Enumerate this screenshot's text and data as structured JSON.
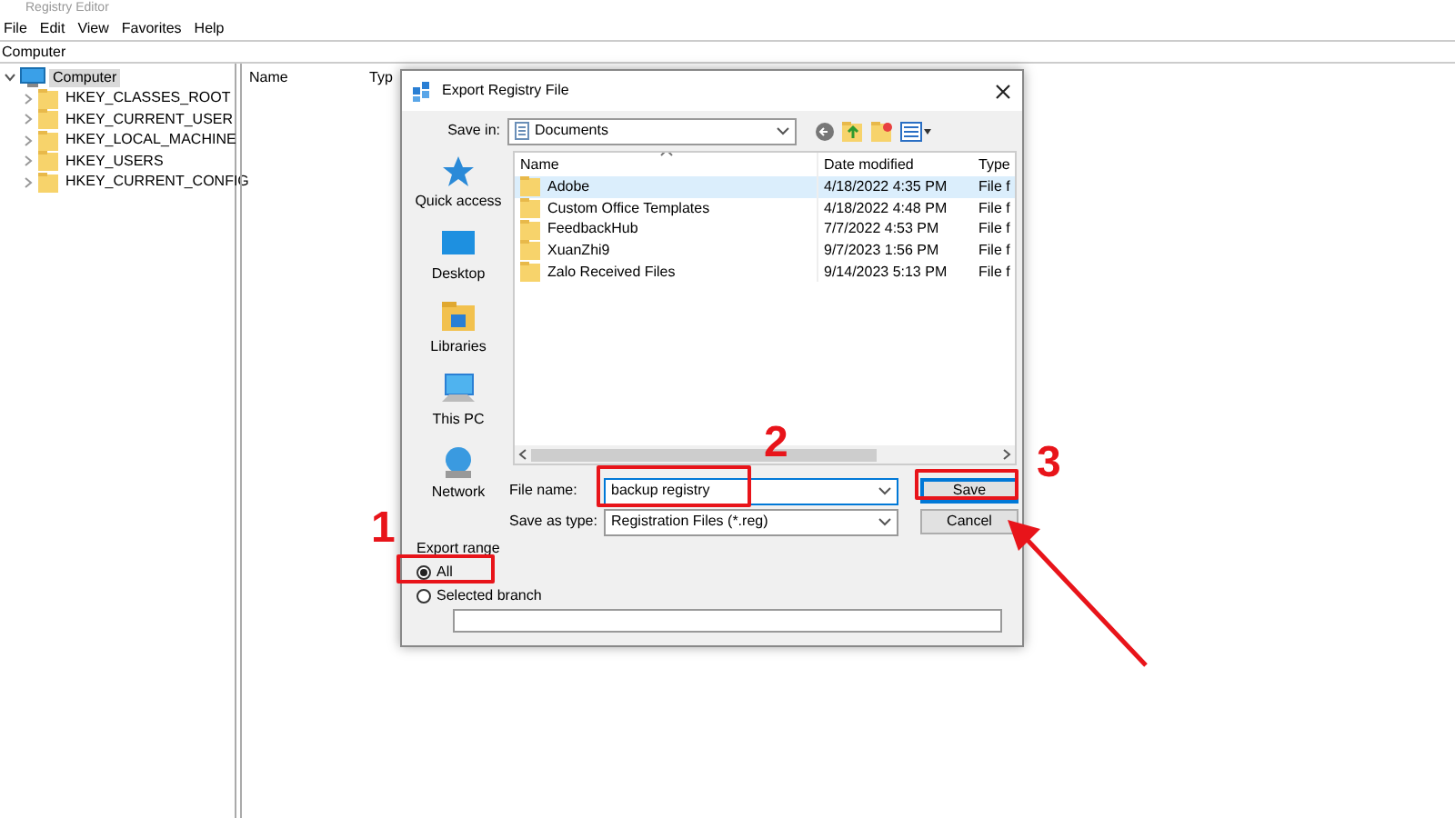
{
  "window": {
    "title": "Registry Editor"
  },
  "menu": [
    "File",
    "Edit",
    "View",
    "Favorites",
    "Help"
  ],
  "address": "Computer",
  "tree": [
    {
      "label": "Computer",
      "expanded": true,
      "selected": true,
      "children": [
        {
          "label": "HKEY_CLASSES_ROOT",
          "expanded": false,
          "selected": false
        },
        {
          "label": "HKEY_CURRENT_USER",
          "expanded": false,
          "selected": false
        },
        {
          "label": "HKEY_LOCAL_MACHINE",
          "expanded": false,
          "selected": false
        },
        {
          "label": "HKEY_USERS",
          "expanded": false,
          "selected": false
        },
        {
          "label": "HKEY_CURRENT_CONFIG",
          "expanded": false,
          "selected": false
        }
      ]
    }
  ],
  "list_columns": [
    "Name",
    "Typ"
  ],
  "dialog": {
    "title": "Export Registry File",
    "save_in_label": "Save in:",
    "save_in": "Documents",
    "places": [
      {
        "label": "Quick access",
        "kind": "star"
      },
      {
        "label": "Desktop",
        "kind": "desktop"
      },
      {
        "label": "Libraries",
        "kind": "libraries"
      },
      {
        "label": "This PC",
        "kind": "pc"
      },
      {
        "label": "Network",
        "kind": "network"
      }
    ],
    "columns": [
      "Name",
      "Date modified",
      "Type"
    ],
    "files": [
      {
        "name": "Adobe",
        "date": "4/18/2022 4:35 PM",
        "type": "File f",
        "selected": true
      },
      {
        "name": "Custom Office Templates",
        "date": "4/18/2022 4:48 PM",
        "type": "File f",
        "selected": false
      },
      {
        "name": "FeedbackHub",
        "date": "7/7/2022 4:53 PM",
        "type": "File f",
        "selected": false
      },
      {
        "name": "XuanZhi9",
        "date": "9/7/2023 1:56 PM",
        "type": "File f",
        "selected": false
      },
      {
        "name": "Zalo Received Files",
        "date": "9/14/2023 5:13 PM",
        "type": "File f",
        "selected": false
      }
    ],
    "file_name_label": "File name:",
    "file_name": "backup registry",
    "type_label": "Save as type:",
    "type_value": "Registration Files (*.reg)",
    "buttons": [
      {
        "label": "Save",
        "default": true
      },
      {
        "label": "Cancel",
        "default": false
      }
    ],
    "export_range": {
      "label": "Export range",
      "options": [
        {
          "label": "All",
          "selected": true
        },
        {
          "label": "Selected branch",
          "selected": false
        }
      ]
    }
  },
  "annotations": [
    {
      "label": "1"
    },
    {
      "label": "2"
    },
    {
      "label": "3"
    }
  ]
}
